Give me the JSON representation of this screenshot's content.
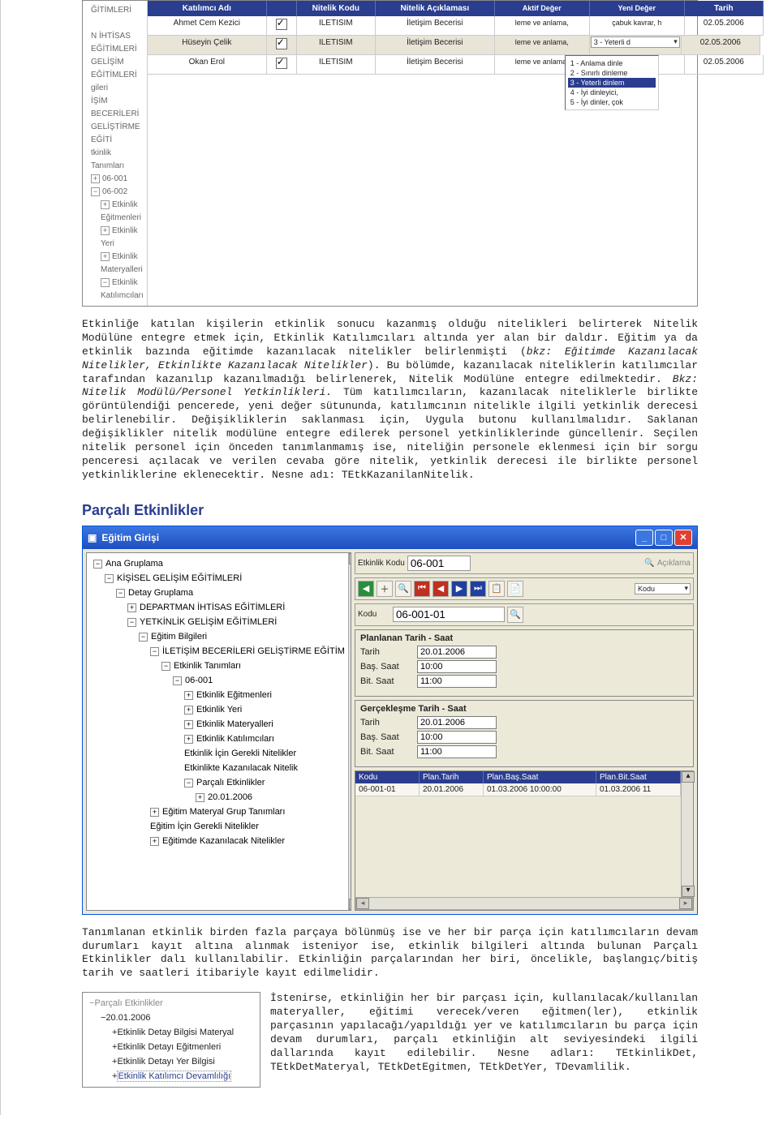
{
  "grid1": {
    "headers": [
      "Katılımcı Adı",
      "",
      "Nitelik Kodu",
      "Nitelik Açıklaması",
      "Aktif Değer",
      "Yeni Değer",
      "Tarih"
    ],
    "rows": [
      {
        "name": "Ahmet Cem Kezici",
        "code": "ILETISIM",
        "desc": "İletişim Becerisi",
        "aktif": "leme ve anlama,",
        "yeni": "çabuk kavrar, h",
        "tarih": "02.05.2006"
      },
      {
        "name": "Hüseyin Çelik",
        "code": "ILETISIM",
        "desc": "İletişim Becerisi",
        "aktif": "leme ve anlama,",
        "yeni": "3 - Yeterli d",
        "tarih": "02.05.2006"
      },
      {
        "name": "Okan Erol",
        "code": "ILETISIM",
        "desc": "İletişim Becerisi",
        "aktif": "leme ve anlama,",
        "yeni": "",
        "tarih": "02.05.2006"
      }
    ],
    "dropdown": [
      "1 - Anlama dinle",
      "2 - Sınırlı dinleme",
      "3 - Yeterli dinlem",
      "4 - İyi dinleyici,",
      "5 - İyi dinler, çok"
    ]
  },
  "leftTree": {
    "items": [
      "ĞİTİMLERİ",
      "N İHTİSAS EĞİTİMLERİ",
      "GELİŞİM EĞİTİMLERİ",
      "gileri",
      "İŞİM BECERİLERİ GELİŞTİRME EĞİTİ",
      "tkinlik Tanımları",
      "06-001",
      "06-002",
      "Etkinlik Eğitmenleri",
      "Etkinlik Yeri",
      "Etkinlik Materyalleri",
      "Etkinlik Katılımcıları"
    ]
  },
  "para1": "Etkinliğe katılan kişilerin etkinlik sonucu kazanmış olduğu nitelikleri belirterek Nitelik Modülüne entegre etmek için, Etkinlik Katılımcıları altında yer alan bir daldır. Eğitim ya da etkinlik bazında eğitimde kazanılacak nitelikler belirlenmişti (",
  "para1i": "bkz: Eğitimde Kazanılacak Nitelikler, Etkinlikte Kazanılacak Nitelikler",
  "para1b": "). Bu bölümde, kazanılacak niteliklerin katılımcılar tarafından kazanılıp kazanılmadığı belirlenerek, Nitelik Modülüne entegre edilmektedir. ",
  "para1i2": "Bkz: Nitelik Modülü/Personel Yetkinlikleri.",
  "para1c": " Tüm katılımcıların, kazanılacak niteliklerle birlikte görüntülendiği pencerede, yeni değer sütununda, katılımcının nitelikle ilgili yetkinlik derecesi belirlenebilir. Değişikliklerin saklanması için, Uygula butonu kullanılmalıdır. Saklanan değişiklikler nitelik modülüne entegre edilerek personel yetkinliklerinde güncellenir. Seçilen nitelik personel için önceden tanımlanmamış ise, niteliğin personele eklenmesi için bir sorgu penceresi açılacak ve verilen cevaba göre nitelik, yetkinlik derecesi ile birlikte personel yetkinliklerine eklenecektir. Nesne adı: TEtkKazanilanNitelik.",
  "h2": "Parçalı Etkinlikler",
  "win": {
    "title": "Eğitim Girişi",
    "tree": [
      "Ana Gruplama",
      "KİŞİSEL GELİŞİM EĞİTİMLERİ",
      "Detay Gruplama",
      "DEPARTMAN İHTİSAS EĞİTİMLERİ",
      "YETKİNLİK GELİŞİM EĞİTİMLERİ",
      "Eğitim Bilgileri",
      "İLETİŞİM BECERİLERİ GELİŞTİRME EĞİTİM",
      "Etkinlik Tanımları",
      "06-001",
      "Etkinlik Eğitmenleri",
      "Etkinlik Yeri",
      "Etkinlik Materyalleri",
      "Etkinlik Katılımcıları",
      "Etkinlik İçin Gerekli Nitelikler",
      "Etkinlikte Kazanılacak Nitelik",
      "Parçalı Etkinlikler",
      "20.01.2006",
      "Eğitim Materyal Grup Tanımları",
      "Eğitim İçin Gerekli Nitelikler",
      "Eğitimde Kazanılacak Nitelikler"
    ],
    "top": {
      "etkLabel": "Etkinlik Kodu",
      "etkVal": "06-001",
      "acik": "Açıklama",
      "koduLabel": "Kodu",
      "koduVal": "06-001-01",
      "koduDd": "Kodu"
    },
    "plan": {
      "title": "Planlanan Tarih - Saat",
      "tL": "Tarih",
      "tV": "20.01.2006",
      "bL": "Baş. Saat",
      "bV": "10:00",
      "eL": "Bit. Saat",
      "eV": "11:00"
    },
    "real": {
      "title": "Gerçekleşme Tarih - Saat",
      "tL": "Tarih",
      "tV": "20.01.2006",
      "bL": "Baş. Saat",
      "bV": "10:00",
      "eL": "Bit. Saat",
      "eV": "11:00"
    },
    "mg": {
      "h": [
        "Kodu",
        "Plan.Tarih",
        "Plan.Baş.Saat",
        "Plan.Bit.Saat"
      ],
      "r": [
        "06-001-01",
        "20.01.2006",
        "01.03.2006 10:00:00",
        "01.03.2006 11"
      ]
    }
  },
  "para2": "Tanımlanan etkinlik birden fazla parçaya bölünmüş ise ve her bir parça için katılımcıların devam durumları kayıt altına alınmak isteniyor ise, etkinlik bilgileri altında bulunan Parçalı Etkinlikler dalı kullanılabilir. Etkinliğin parçalarından her biri, öncelikle, başlangıç/bitiş tarih ve saatleri itibariyle kayıt edilmelidir.",
  "miniTree": [
    "Parçalı Etkinlikler",
    "20.01.2006",
    "Etkinlik Detay Bilgisi Materyal",
    "Etkinlik Detayı Eğitmenleri",
    "Etkinlik Detayı Yer Bilgisi",
    "Etkinlik Katılımcı Devamlılığı"
  ],
  "para3": "İstenirse, etkinliğin her bir parçası için, kullanılacak/kullanılan materyaller, eğitimi verecek/veren eğitmen(ler), etkinlik parçasının yapılacağı/yapıldığı yer ve katılımcıların bu parça için devam durumları, parçalı etkinliğin alt seviyesindeki ilgili dallarında kayıt edilebilir. Nesne adları: TEtkinlikDet, TEtkDetMateryal, TEtkDetEgitmen, TEtkDetYer, TDevamlilik."
}
